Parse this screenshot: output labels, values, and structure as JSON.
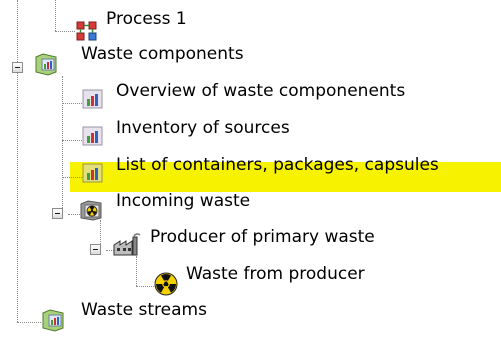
{
  "tree": {
    "items": [
      {
        "label": "Process 1",
        "icon": "process-diagram-icon"
      },
      {
        "label": "Waste components",
        "icon": "folder-chart-icon",
        "expanded": true
      },
      {
        "label": "Overview of waste componenents",
        "icon": "bar-chart-icon"
      },
      {
        "label": "Inventory of sources",
        "icon": "bar-chart-icon"
      },
      {
        "label": "List of containers, packages, capsules",
        "icon": "bar-chart-folder-icon",
        "highlighted": true
      },
      {
        "label": "Incoming waste",
        "icon": "radiation-folder-icon",
        "expanded": true
      },
      {
        "label": "Producer of primary waste",
        "icon": "factory-icon",
        "expanded": true
      },
      {
        "label": "Waste from producer",
        "icon": "radiation-icon"
      },
      {
        "label": "Waste streams",
        "icon": "folder-chart-icon"
      }
    ]
  },
  "colors": {
    "highlight": "#f7f200",
    "connector": "#8a8a8a",
    "chart_icon_bg": "#e7e2ee",
    "bar_green": "#3f9f3f",
    "bar_red": "#d03030",
    "bar_blue": "#3060c0",
    "folder_green": "#a9d17a",
    "radiation_yellow": "#f4d000"
  }
}
